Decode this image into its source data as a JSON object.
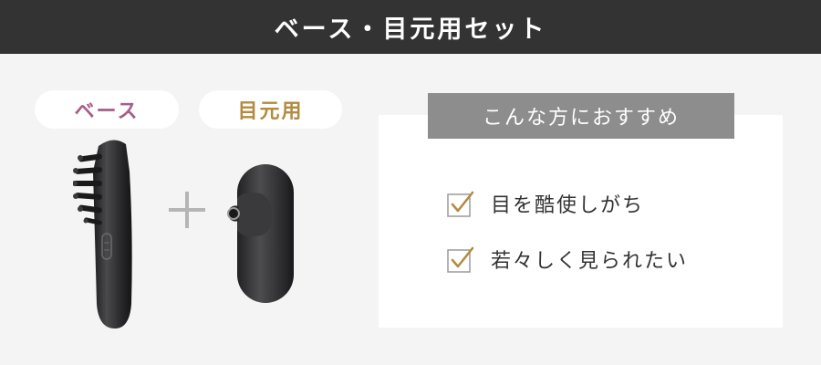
{
  "header": {
    "title": "ベース・目元用セット"
  },
  "products": {
    "base": {
      "label": "ベース",
      "color": "#a65e88"
    },
    "eye": {
      "label": "目元用",
      "color": "#b48a3e"
    }
  },
  "recommend": {
    "title": "こんな方におすすめ",
    "items": [
      {
        "text": "目を酷使しがち",
        "icon": "checkbox-checked-icon"
      },
      {
        "text": "若々しく見られたい",
        "icon": "checkbox-checked-icon"
      }
    ]
  },
  "colors": {
    "header_bg": "#333333",
    "page_bg": "#f4f4f4",
    "title_bg": "#8d8d8d",
    "check_accent": "#b48a3e"
  }
}
